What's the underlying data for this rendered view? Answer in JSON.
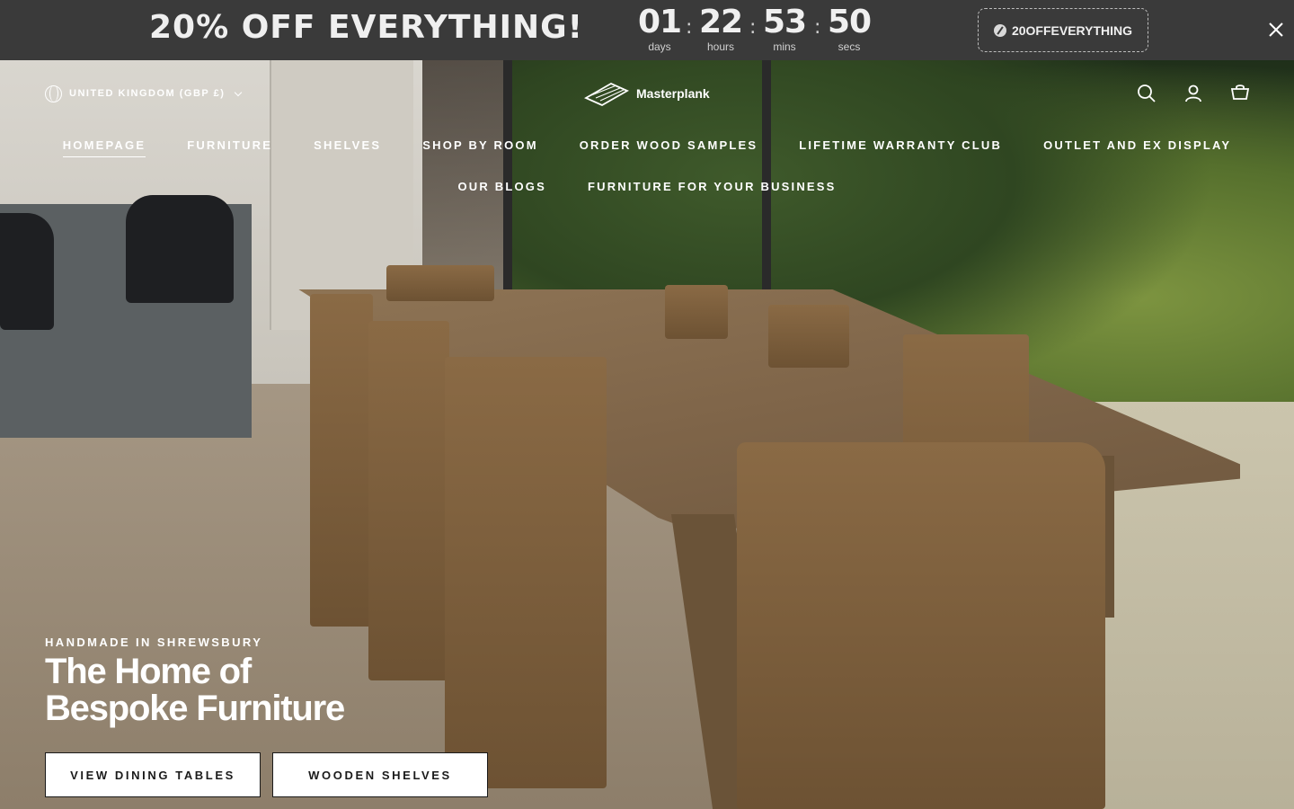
{
  "promo_bar": {
    "headline": "20% OFF EVERYTHING!",
    "countdown": {
      "days": "01",
      "days_label": "days",
      "hours": "22",
      "hours_label": "hours",
      "mins": "53",
      "mins_label": "mins",
      "secs": "50",
      "secs_label": "secs",
      "separator": ":"
    },
    "coupon_code": "20OFFEVERYTHING",
    "close_icon": "close-icon",
    "background_color": "#3a3a3a"
  },
  "header": {
    "locale": "UNITED KINGDOM (GBP £)",
    "brand": "Masterplank",
    "icons": [
      "globe-icon",
      "chevron-down-icon",
      "search-icon",
      "user-icon",
      "cart-icon"
    ]
  },
  "nav": {
    "row1": [
      "HOMEPAGE",
      "FURNITURE",
      "SHELVES",
      "SHOP BY ROOM",
      "ORDER WOOD SAMPLES",
      "LIFETIME WARRANTY CLUB",
      "OUTLET AND EX DISPLAY"
    ],
    "row2": [
      "OUR BLOGS",
      "FURNITURE FOR YOUR BUSINESS"
    ],
    "active": "HOMEPAGE"
  },
  "hero": {
    "eyebrow": "HANDMADE IN SHREWSBURY",
    "title_line1": "The Home of",
    "title_line2": "Bespoke Furniture",
    "primary_button": "VIEW DINING TABLES",
    "secondary_button": "WOODEN SHELVES"
  }
}
